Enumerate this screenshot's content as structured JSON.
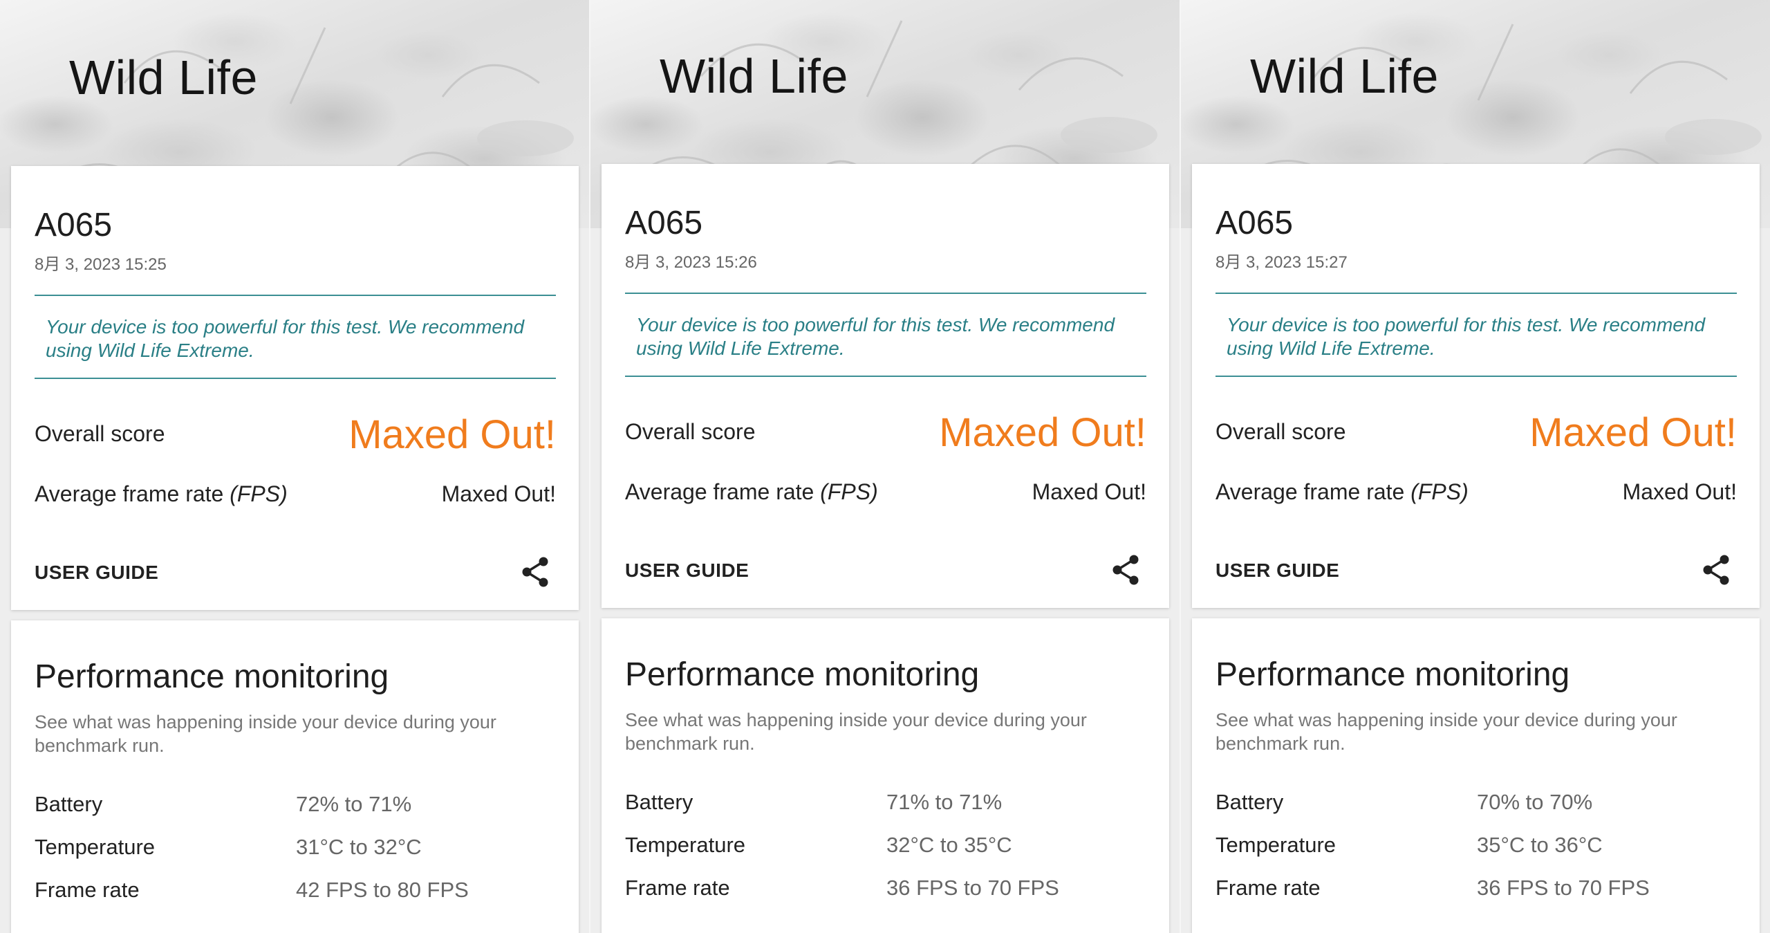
{
  "colors": {
    "accent_orange": "#f07c1d",
    "notice_teal": "#2a7f86",
    "divider_teal": "#3b8f94"
  },
  "panels": [
    {
      "hero_title": "Wild Life",
      "device": "A065",
      "date": "8月 3, 2023 15:25",
      "notice": "Your device is too powerful for this test. We recommend using Wild Life Extreme.",
      "overall_label": "Overall score",
      "overall_value": "Maxed Out!",
      "fps_label": "Average frame rate",
      "fps_unit": "(FPS)",
      "fps_value": "Maxed Out!",
      "user_guide": "USER GUIDE",
      "share_icon": "share-icon",
      "perf_title": "Performance monitoring",
      "perf_desc": "See what was happening inside your device during your benchmark run.",
      "metrics": [
        {
          "label": "Battery",
          "value": "72% to 71%"
        },
        {
          "label": "Temperature",
          "value": "31°C to 32°C"
        },
        {
          "label": "Frame rate",
          "value": "42 FPS to 80 FPS"
        }
      ]
    },
    {
      "hero_title": "Wild Life",
      "device": "A065",
      "date": "8月 3, 2023 15:26",
      "notice": "Your device is too powerful for this test. We recommend using Wild Life Extreme.",
      "overall_label": "Overall score",
      "overall_value": "Maxed Out!",
      "fps_label": "Average frame rate",
      "fps_unit": "(FPS)",
      "fps_value": "Maxed Out!",
      "user_guide": "USER GUIDE",
      "share_icon": "share-icon",
      "perf_title": "Performance monitoring",
      "perf_desc": "See what was happening inside your device during your benchmark run.",
      "metrics": [
        {
          "label": "Battery",
          "value": "71% to 71%"
        },
        {
          "label": "Temperature",
          "value": "32°C to 35°C"
        },
        {
          "label": "Frame rate",
          "value": "36 FPS to 70 FPS"
        }
      ]
    },
    {
      "hero_title": "Wild Life",
      "device": "A065",
      "date": "8月 3, 2023 15:27",
      "notice": "Your device is too powerful for this test. We recommend using Wild Life Extreme.",
      "overall_label": "Overall score",
      "overall_value": "Maxed Out!",
      "fps_label": "Average frame rate",
      "fps_unit": "(FPS)",
      "fps_value": "Maxed Out!",
      "user_guide": "USER GUIDE",
      "share_icon": "share-icon",
      "perf_title": "Performance monitoring",
      "perf_desc": "See what was happening inside your device during your benchmark run.",
      "metrics": [
        {
          "label": "Battery",
          "value": "70% to 70%"
        },
        {
          "label": "Temperature",
          "value": "35°C to 36°C"
        },
        {
          "label": "Frame rate",
          "value": "36 FPS to 70 FPS"
        }
      ]
    }
  ]
}
